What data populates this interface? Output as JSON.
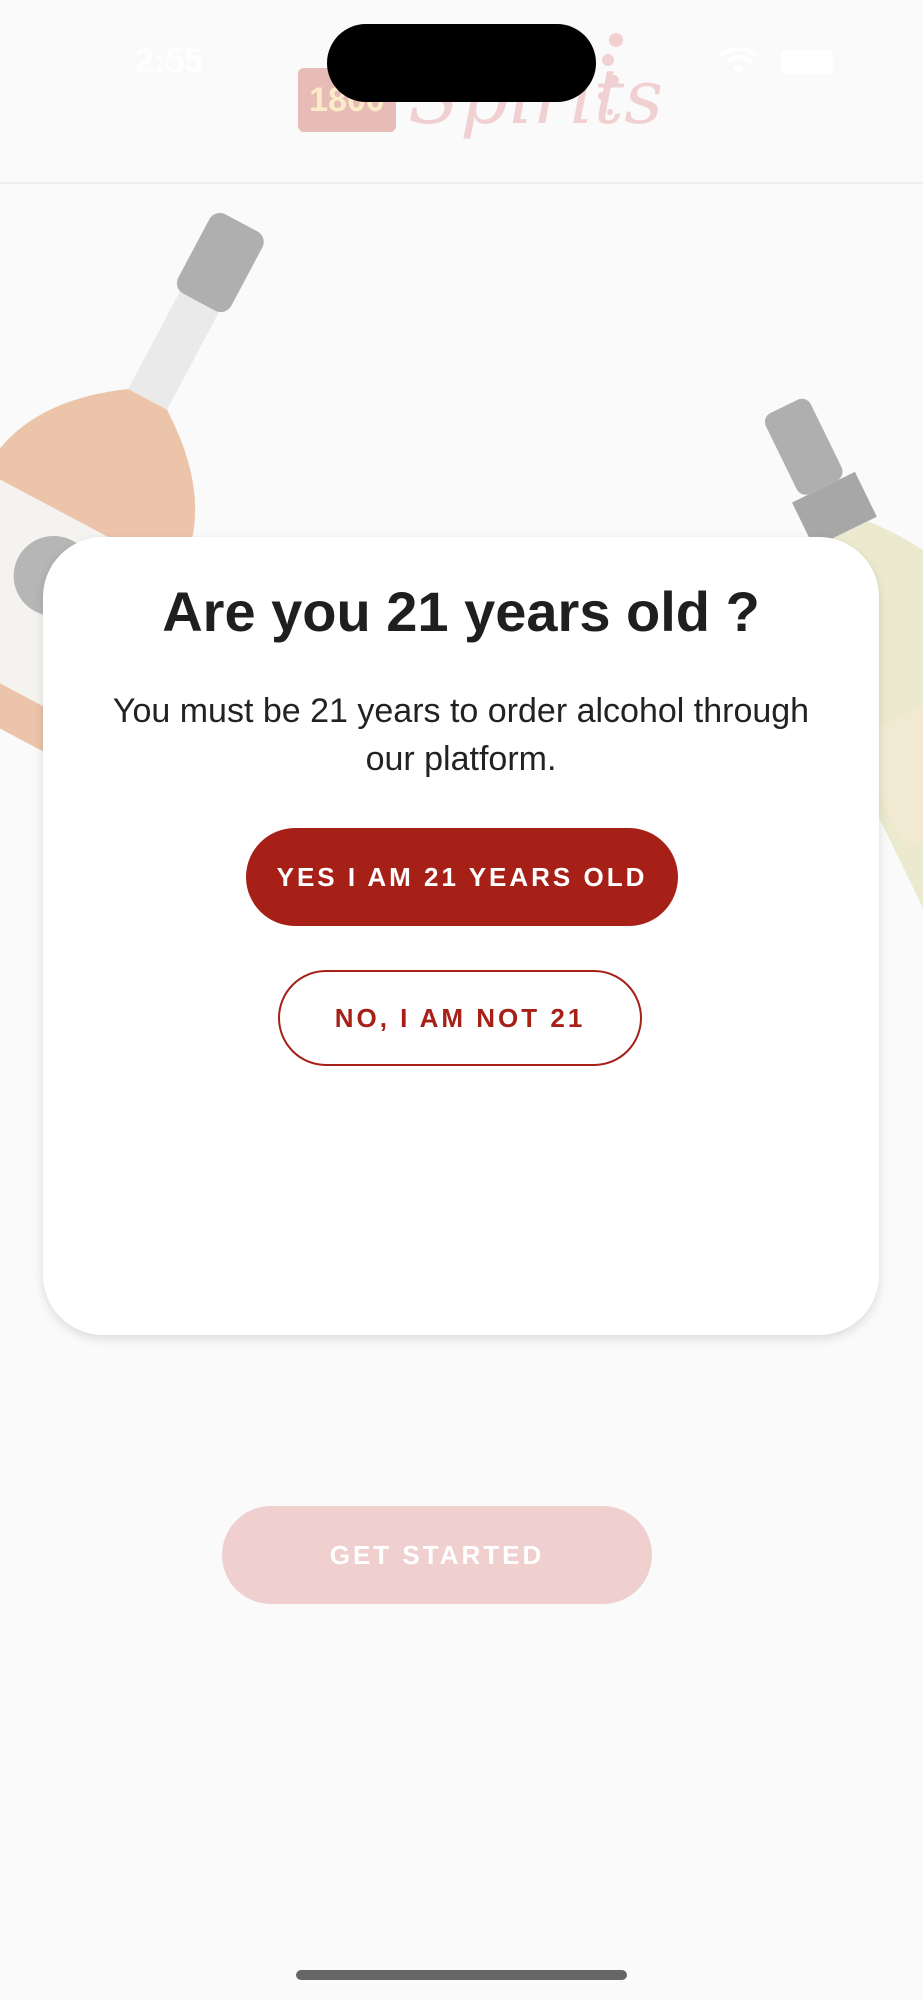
{
  "status_bar": {
    "time": "2:55"
  },
  "header": {
    "logo_text": "1800",
    "logo_script": "Spirits"
  },
  "modal": {
    "title": "Are you 21 years old ?",
    "message": "You must be 21 years to order alcohol through our platform.",
    "yes_label": "YES I AM 21 YEARS OLD",
    "no_label": "NO, I AM NOT 21"
  },
  "background": {
    "get_started_label": "GET STARTED"
  },
  "colors": {
    "accent": "#a62018",
    "accent_faded": "#f0cfcf",
    "background": "#fafafa"
  },
  "icons": {
    "wifi": "wifi-icon",
    "battery": "battery-icon"
  }
}
